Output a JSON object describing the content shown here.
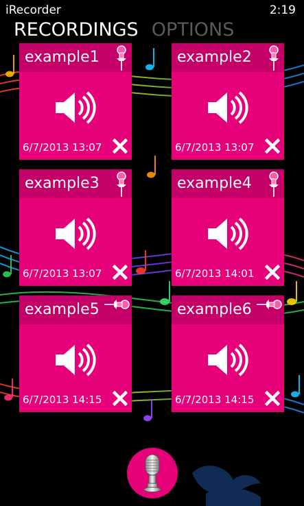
{
  "app": {
    "title": "iRecorder",
    "clock": "2:19"
  },
  "pivot": {
    "tabs": [
      {
        "label": "RECORDINGS",
        "active": true
      },
      {
        "label": "OPTIONS",
        "active": false
      }
    ]
  },
  "recordings": [
    {
      "name": "example1",
      "date": "6/7/2013 13:07",
      "pinned": true
    },
    {
      "name": "example2",
      "date": "6/7/2013 13:07",
      "pinned": true
    },
    {
      "name": "example3",
      "date": "6/7/2013 13:07",
      "pinned": true
    },
    {
      "name": "example4",
      "date": "6/7/2013 14:01",
      "pinned": true
    },
    {
      "name": "example5",
      "date": "6/7/2013 14:15",
      "pinned": false
    },
    {
      "name": "example6",
      "date": "6/7/2013 14:15",
      "pinned": false
    }
  ],
  "icons": {
    "tile_icon": "speaker-icon",
    "pin_icon": "pushpin-icon",
    "delete_icon": "close-icon",
    "record_icon": "microphone-icon"
  },
  "colors": {
    "accent": "#e6007a",
    "tile_header": "#c40068",
    "background": "#000000",
    "inactive_tab": "#5a5a5a"
  }
}
